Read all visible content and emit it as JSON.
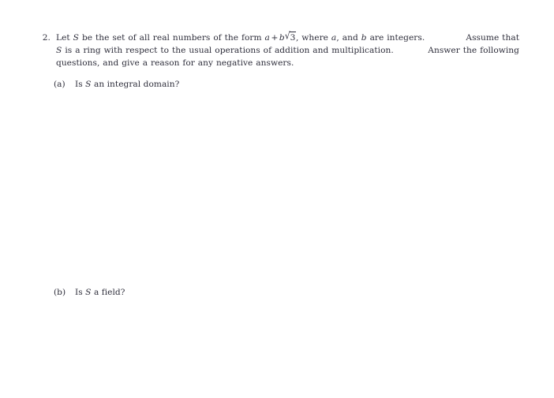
{
  "document": {
    "background_color": "#ffffff",
    "text_color": "#2d2d3a"
  },
  "problem": {
    "number": "2.",
    "lines": [
      {
        "segments": [
          {
            "type": "text",
            "value": "Let "
          },
          {
            "type": "math_var",
            "value": "S"
          },
          {
            "type": "text",
            "value": " be the set of all real numbers of the form "
          },
          {
            "type": "math_var",
            "value": "a"
          },
          {
            "type": "math_op",
            "value": "+"
          },
          {
            "type": "math_var",
            "value": "b"
          },
          {
            "type": "math_sqrt",
            "value": "3"
          },
          {
            "type": "text",
            "value": ", where "
          },
          {
            "type": "math_var",
            "value": "a"
          },
          {
            "type": "text",
            "value": ", and "
          },
          {
            "type": "math_var",
            "value": "b"
          },
          {
            "type": "text",
            "value": " are integers.  Assume that"
          }
        ],
        "plain": "Let S be the set of all real numbers of the form a + b√3, where a, and b are integers.  Assume that"
      },
      {
        "segments": [
          {
            "type": "math_var",
            "value": "S"
          },
          {
            "type": "text",
            "value": " is a ring with respect to the usual operations of addition and multiplication.  Answer the following"
          }
        ],
        "plain": "S is a ring with respect to the usual operations of addition and multiplication.  Answer the following"
      },
      {
        "segments": [
          {
            "type": "text",
            "value": "questions, and give a reason for any negative answers."
          }
        ],
        "plain": "questions, and give a reason for any negative answers."
      }
    ],
    "line1_head": "Let ",
    "line1_s": "S",
    "line1_mid": " be the set of all real numbers of the form ",
    "line1_a": "a",
    "line1_plus": "+",
    "line1_b": "b",
    "line1_radicand": "3",
    "line1_radical_sign": "√",
    "line1_after_radical": ", where ",
    "line1_a2": "a",
    "line1_mid2": ", and ",
    "line1_b2": "b",
    "line1_tail": " are integers.",
    "line1_tail2": "Assume that",
    "line2_s": "S",
    "line2_text": " is a ring with respect to the usual operations of addition and multiplication.",
    "line2_tail": "Answer the following",
    "line3_text": "questions, and give a reason for any negative answers."
  },
  "subparts": [
    {
      "label": "(a)",
      "prefix": "Is ",
      "variable": "S",
      "suffix": " an integral domain?",
      "plain": "(a) Is S an integral domain?"
    },
    {
      "label": "(b)",
      "prefix": "Is ",
      "variable": "S",
      "suffix": " a field?",
      "plain": "(b) Is S a field?"
    }
  ]
}
